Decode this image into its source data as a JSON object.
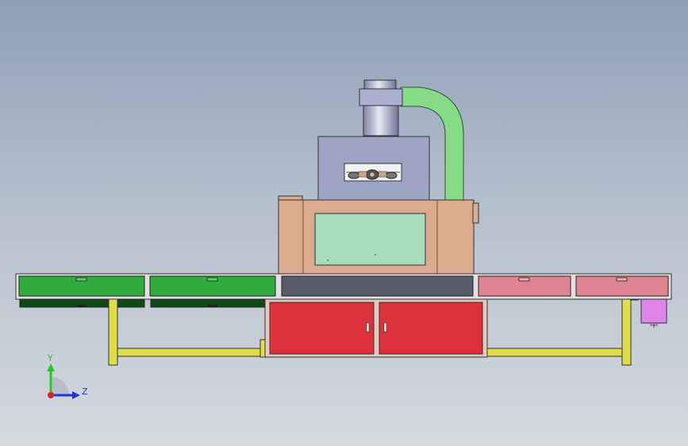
{
  "axis_triad": {
    "y_label": "Y",
    "z_label": "Z",
    "y_color": "#22cc22",
    "z_color": "#2233dd",
    "x_color": "#dd2222"
  },
  "colors": {
    "conveyor_green": "#2fac3c",
    "conveyor_pink": "#de8591",
    "conveyor_dark": "#5b5c6a",
    "housing_tan": "#dcaa8c",
    "window_green": "#a8dcbc",
    "cabinet_red": "#dc303c",
    "duct_green": "#86dc86",
    "frame_yellow": "#e0de48",
    "lamp_housing": "#9ea4c4",
    "motor_magenta": "#dc84e8"
  }
}
